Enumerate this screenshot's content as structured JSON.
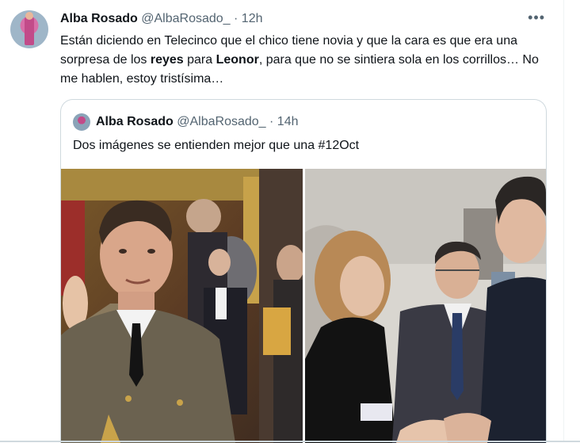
{
  "tweet": {
    "author_name": "Alba Rosado",
    "author_handle": "@AlbaRosado_",
    "time": "12h",
    "more_icon": "more-horizontal-icon",
    "text_part1": "Están diciendo en Telecinco que el chico tiene novia y que la cara es que era una sorpresa de los ",
    "bold1": "reyes",
    "text_part2": " para ",
    "bold2": "Leonor",
    "text_part3": ", para que no se sintiera sola en los corrillos… No me hablen, estoy tristísima…"
  },
  "quoted": {
    "author_name": "Alba Rosado",
    "author_handle": "@AlbaRosado_",
    "time": "14h",
    "text": "Dos imágenes se entienden mejor que una #12Oct"
  },
  "colors": {
    "text": "#0f1419",
    "secondary": "#536471",
    "border": "#cfd9de"
  }
}
